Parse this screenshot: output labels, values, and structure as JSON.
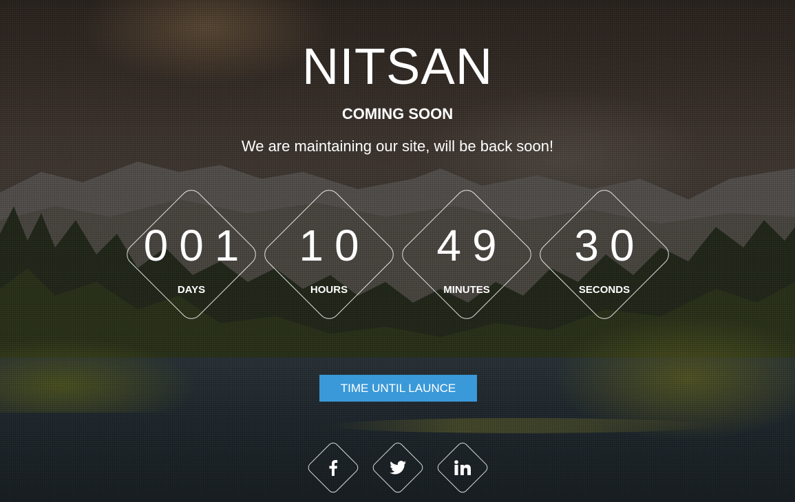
{
  "site": {
    "title": "NITSAN",
    "subtitle": "COMING SOON",
    "tagline": "We are maintaining our site, will be back soon!"
  },
  "countdown": [
    {
      "value": "001",
      "label": "DAYS"
    },
    {
      "value": "10",
      "label": "HOURS"
    },
    {
      "value": "49",
      "label": "MINUTES"
    },
    {
      "value": "30",
      "label": "SECONDS"
    }
  ],
  "launch_button": {
    "label": "TIME UNTIL LAUNCE",
    "color": "#3a99d8"
  },
  "social": [
    {
      "icon": "facebook-icon"
    },
    {
      "icon": "twitter-icon"
    },
    {
      "icon": "linkedin-icon"
    }
  ]
}
